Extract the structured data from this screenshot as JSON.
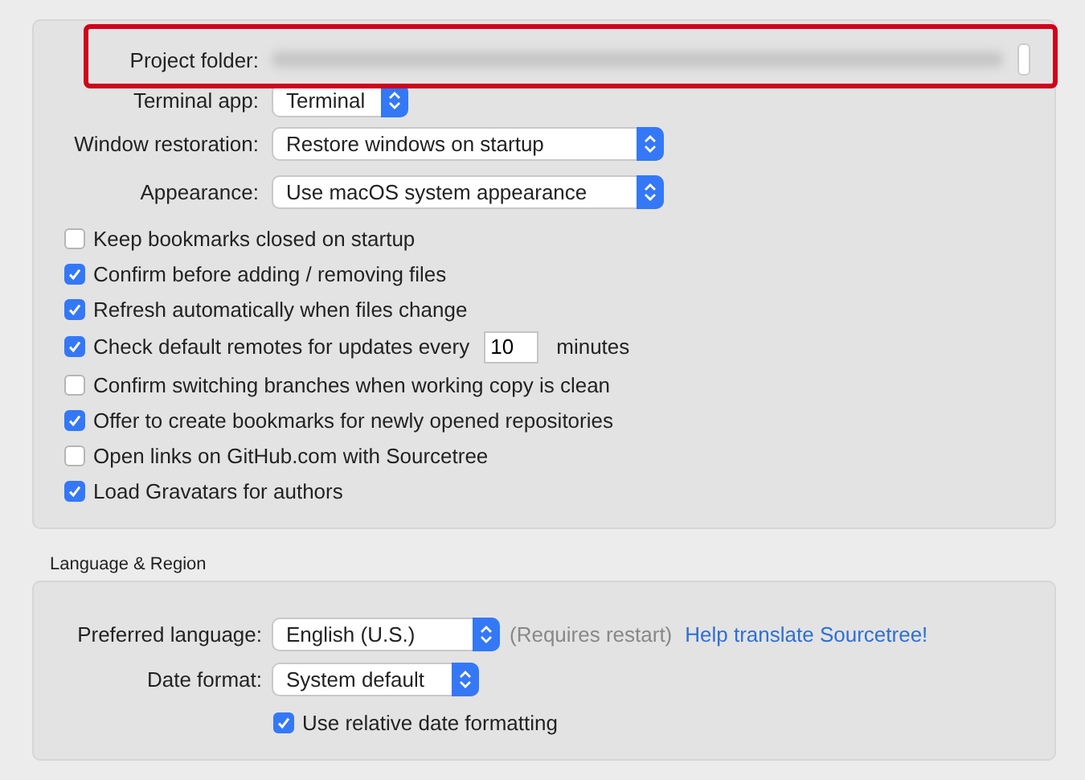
{
  "miscellaneous": {
    "project_folder": {
      "label": "Project folder:",
      "highlighted": true
    },
    "popups": [
      {
        "label": "Terminal app:",
        "value": "Terminal"
      },
      {
        "label": "Window restoration:",
        "value": "Restore windows on startup"
      },
      {
        "label": "Appearance:",
        "value": "Use macOS system appearance"
      }
    ],
    "options": [
      {
        "kind": "checkbox",
        "label": "Keep bookmarks closed on startup",
        "checked": false
      },
      {
        "kind": "checkbox",
        "label": "Confirm before adding / removing files",
        "checked": true
      },
      {
        "kind": "checkbox",
        "label": "Refresh automatically when files change",
        "checked": true
      },
      {
        "kind": "interval",
        "label": "Check default remotes for updates every",
        "checked": true,
        "value": "10",
        "suffix": "minutes"
      },
      {
        "kind": "checkbox",
        "label": "Confirm switching branches when working copy is clean",
        "checked": false
      },
      {
        "kind": "checkbox",
        "label": "Offer to create bookmarks for newly opened repositories",
        "checked": true
      },
      {
        "kind": "checkbox",
        "label": "Open links on GitHub.com with Sourcetree",
        "checked": false
      },
      {
        "kind": "checkbox",
        "label": "Load Gravatars for authors",
        "checked": true
      }
    ]
  },
  "language_region": {
    "title": "Language & Region",
    "preferred_language": {
      "label": "Preferred language:",
      "value": "English (U.S.)",
      "note": "(Requires restart)",
      "link": "Help translate Sourcetree!"
    },
    "date_format": {
      "label": "Date format:",
      "value": "System default"
    },
    "relative_dates": {
      "label": "Use relative date formatting",
      "checked": true
    }
  }
}
